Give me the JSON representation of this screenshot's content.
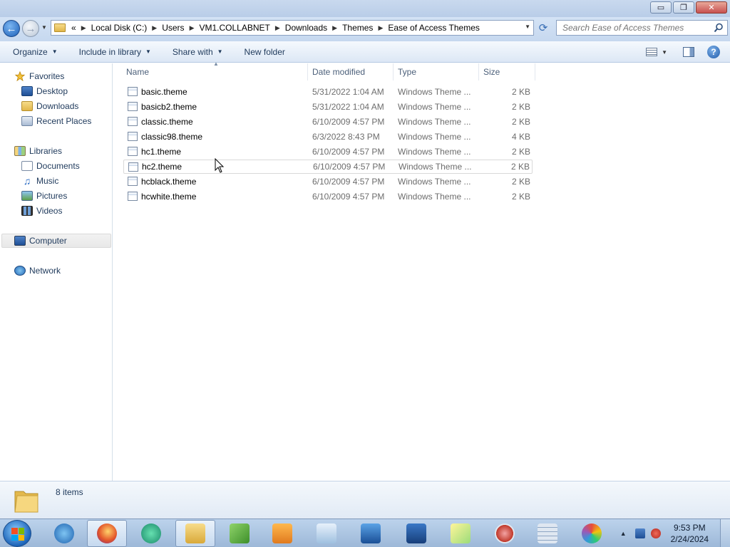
{
  "window": {
    "minimize": "▭",
    "maximize": "❐",
    "close": "✕"
  },
  "address": {
    "overflow": "«",
    "crumbs": [
      "Local Disk (C:)",
      "Users",
      "VM1.COLLABNET",
      "Downloads",
      "Themes",
      "Ease of Access Themes"
    ],
    "search_placeholder": "Search Ease of Access Themes"
  },
  "toolbar": {
    "organize": "Organize",
    "include_in_library": "Include in library",
    "share_with": "Share with",
    "new_folder": "New folder"
  },
  "sidebar": {
    "favorites": {
      "label": "Favorites",
      "items": [
        "Desktop",
        "Downloads",
        "Recent Places"
      ]
    },
    "libraries": {
      "label": "Libraries",
      "items": [
        "Documents",
        "Music",
        "Pictures",
        "Videos"
      ]
    },
    "computer": "Computer",
    "network": "Network"
  },
  "columns": {
    "name": "Name",
    "date": "Date modified",
    "type": "Type",
    "size": "Size"
  },
  "files": [
    {
      "name": "basic.theme",
      "date": "5/31/2022 1:04 AM",
      "type": "Windows Theme ...",
      "size": "2 KB"
    },
    {
      "name": "basicb2.theme",
      "date": "5/31/2022 1:04 AM",
      "type": "Windows Theme ...",
      "size": "2 KB"
    },
    {
      "name": "classic.theme",
      "date": "6/10/2009 4:57 PM",
      "type": "Windows Theme ...",
      "size": "2 KB"
    },
    {
      "name": "classic98.theme",
      "date": "6/3/2022 8:43 PM",
      "type": "Windows Theme ...",
      "size": "4 KB"
    },
    {
      "name": "hc1.theme",
      "date": "6/10/2009 4:57 PM",
      "type": "Windows Theme ...",
      "size": "2 KB"
    },
    {
      "name": "hc2.theme",
      "date": "6/10/2009 4:57 PM",
      "type": "Windows Theme ...",
      "size": "2 KB"
    },
    {
      "name": "hcblack.theme",
      "date": "6/10/2009 4:57 PM",
      "type": "Windows Theme ...",
      "size": "2 KB"
    },
    {
      "name": "hcwhite.theme",
      "date": "6/10/2009 4:57 PM",
      "type": "Windows Theme ...",
      "size": "2 KB"
    }
  ],
  "details": {
    "count": "8 items"
  },
  "taskbar": {
    "apps": [
      "internet-explorer-icon",
      "firefox-icon",
      "media-icon",
      "file-explorer-icon",
      "notepad-plus-icon",
      "media-player-icon",
      "notepad-icon",
      "remote-desktop-icon",
      "network-icon",
      "sticky-notes-icon",
      "snipping-tool-icon",
      "calculator-icon",
      "paint-icon"
    ],
    "time": "9:53 PM",
    "date": "2/24/2024"
  }
}
